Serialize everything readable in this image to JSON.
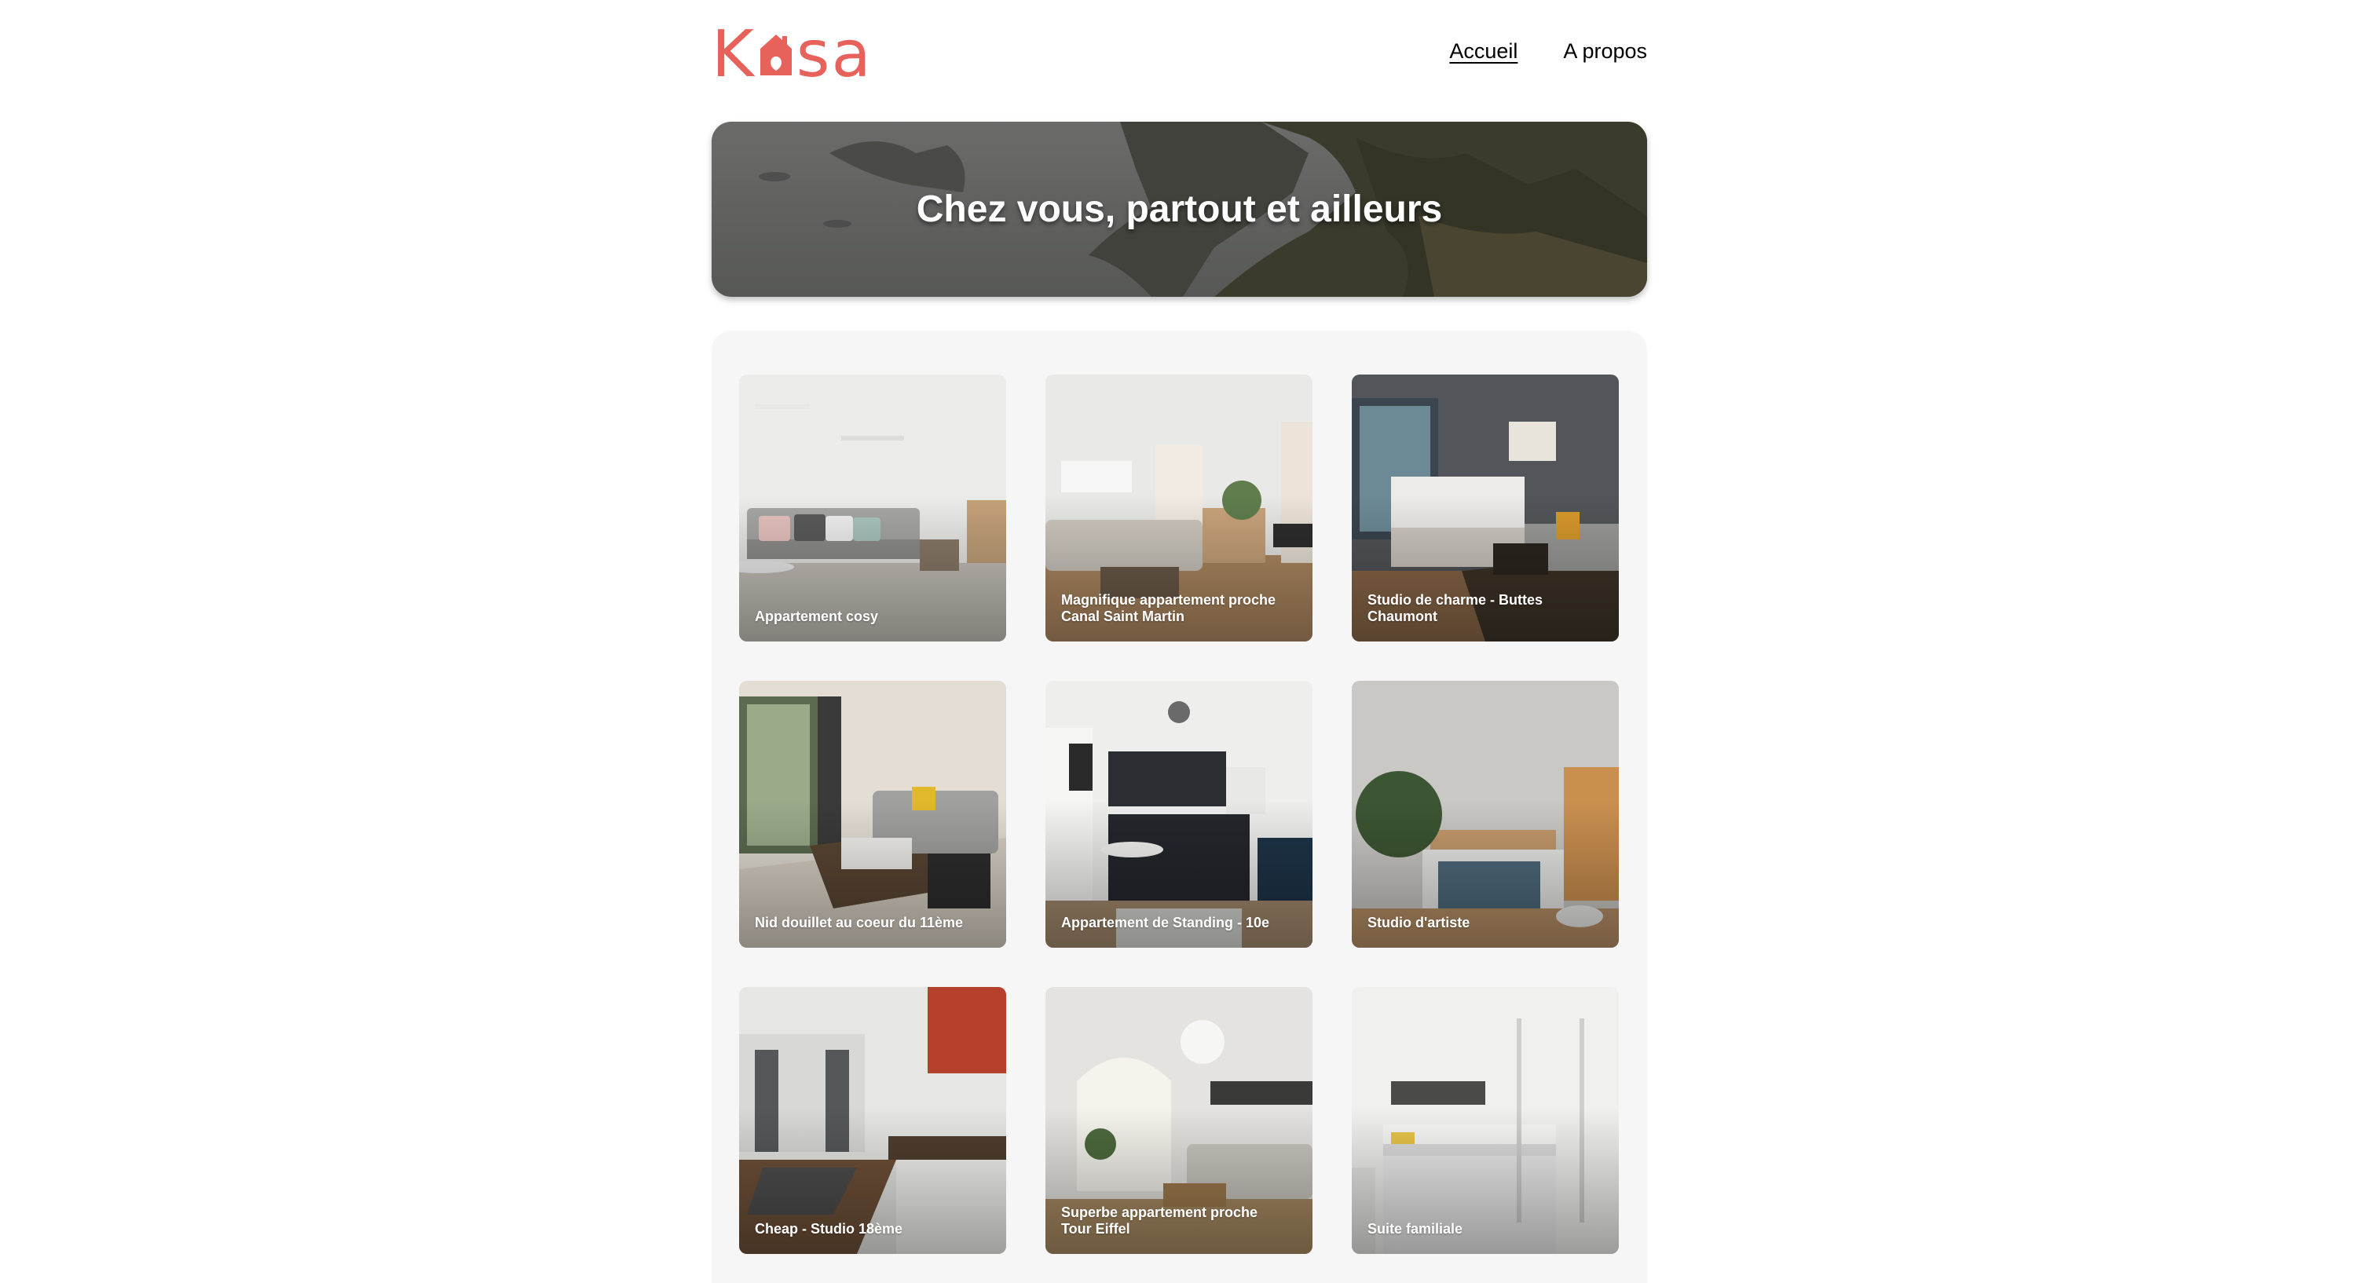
{
  "header": {
    "logo_left": "K",
    "logo_right": "sa",
    "nav": [
      {
        "label": "Accueil",
        "active": true
      },
      {
        "label": "A propos",
        "active": false
      }
    ]
  },
  "banner": {
    "title": "Chez vous, partout et ailleurs"
  },
  "listings": [
    {
      "title": "Appartement cosy"
    },
    {
      "title": "Magnifique appartement proche Canal Saint Martin"
    },
    {
      "title": "Studio de charme - Buttes Chaumont"
    },
    {
      "title": "Nid douillet au coeur du 11ème"
    },
    {
      "title": "Appartement de Standing - 10e"
    },
    {
      "title": "Studio d'artiste"
    },
    {
      "title": "Cheap - Studio 18ème"
    },
    {
      "title": "Superbe appartement proche Tour Eiffel"
    },
    {
      "title": "Suite familiale"
    }
  ],
  "colors": {
    "brand": "#e8625c",
    "gallery_bg": "#f6f6f6"
  }
}
